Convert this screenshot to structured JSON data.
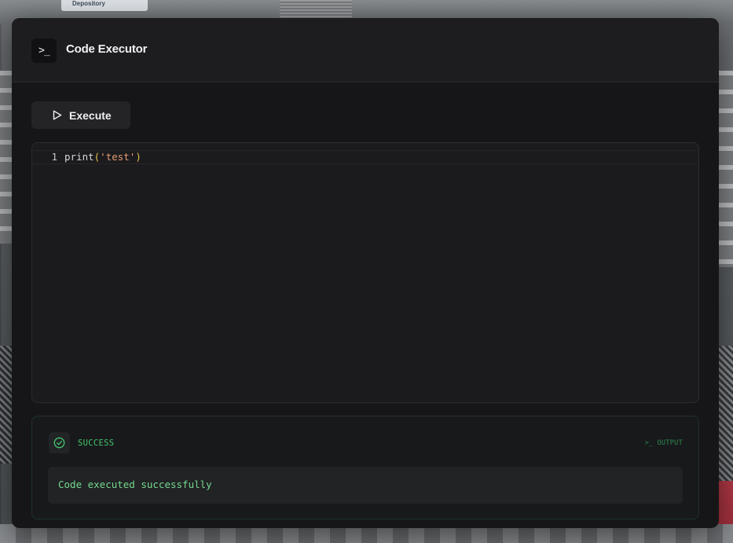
{
  "background": {
    "sign_text": "Depository"
  },
  "header": {
    "icon_glyph": ">_",
    "title": "Code Executor"
  },
  "toolbar": {
    "execute_label": "Execute"
  },
  "editor": {
    "lines": [
      {
        "number": "1",
        "tokens": {
          "func": "print",
          "open_paren": "(",
          "string": "'test'",
          "close_paren": ")"
        }
      }
    ]
  },
  "output": {
    "status": "SUCCESS",
    "tag_prompt": ">_",
    "tag_label": "OUTPUT",
    "message": "Code executed successfully"
  },
  "colors": {
    "success_green": "#45c46c",
    "output_text_green": "#74d98f",
    "panel_bg": "#161618",
    "header_bg": "#1d1d20"
  }
}
